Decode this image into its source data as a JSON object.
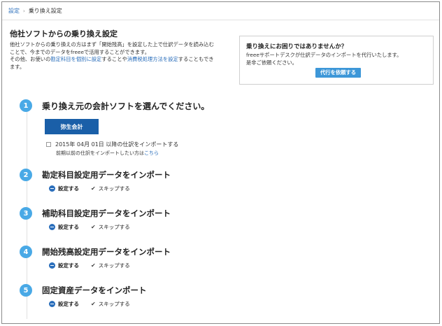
{
  "breadcrumb": {
    "root": "設定",
    "separator": "›",
    "current": "乗り換え設定"
  },
  "page": {
    "title": "他社ソフトからの乗り換え設定",
    "intro_line1": "他社ソフトからの乗り換えの方はまず「開始残高」を設定した上で仕訳データを読み込む",
    "intro_line2": "ことで、今までのデータをfreeeで活用することができます。",
    "intro_line3_prefix": "その他、お使いの",
    "intro_link1": "勘定科目を個別に設定",
    "intro_mid": "することや",
    "intro_link2": "消費税処理方法を設定",
    "intro_line3_suffix": "することもでき",
    "intro_line4": "ます。"
  },
  "help": {
    "title": "乗り換えにお困りではありませんか？",
    "text1": "freeeサポートデスクが仕訳データのインポートを代行いたします。",
    "text2": "是非ご依頼ください。",
    "button": "代行を依頼する"
  },
  "step1": {
    "num": "1",
    "title": "乗り換え元の会計ソフトを選んでください。",
    "software_button": "弥生会計",
    "date_text": "2015年 04月 01日 以降の仕訳をインポートする",
    "note_prefix": "前期以前の仕訳をインポートしたい方は",
    "note_link": "こちら"
  },
  "steps": [
    {
      "num": "2",
      "title": "勘定科目設定用データをインポート",
      "set_label": "設定する",
      "skip_label": "スキップする"
    },
    {
      "num": "3",
      "title": "補助科目設定用データをインポート",
      "set_label": "設定する",
      "skip_label": "スキップする"
    },
    {
      "num": "4",
      "title": "開始残高設定用データをインポート",
      "set_label": "設定する",
      "skip_label": "スキップする"
    },
    {
      "num": "5",
      "title": "固定資産データをインポート",
      "set_label": "設定する",
      "skip_label": "スキップする"
    }
  ],
  "icons": {
    "check": "✔",
    "minus": "minus-circle-icon"
  },
  "colors": {
    "link": "#2a6ebb",
    "step_badge": "#49a9e6",
    "primary_button": "#1a5fa8",
    "help_button": "#3d97d8"
  }
}
